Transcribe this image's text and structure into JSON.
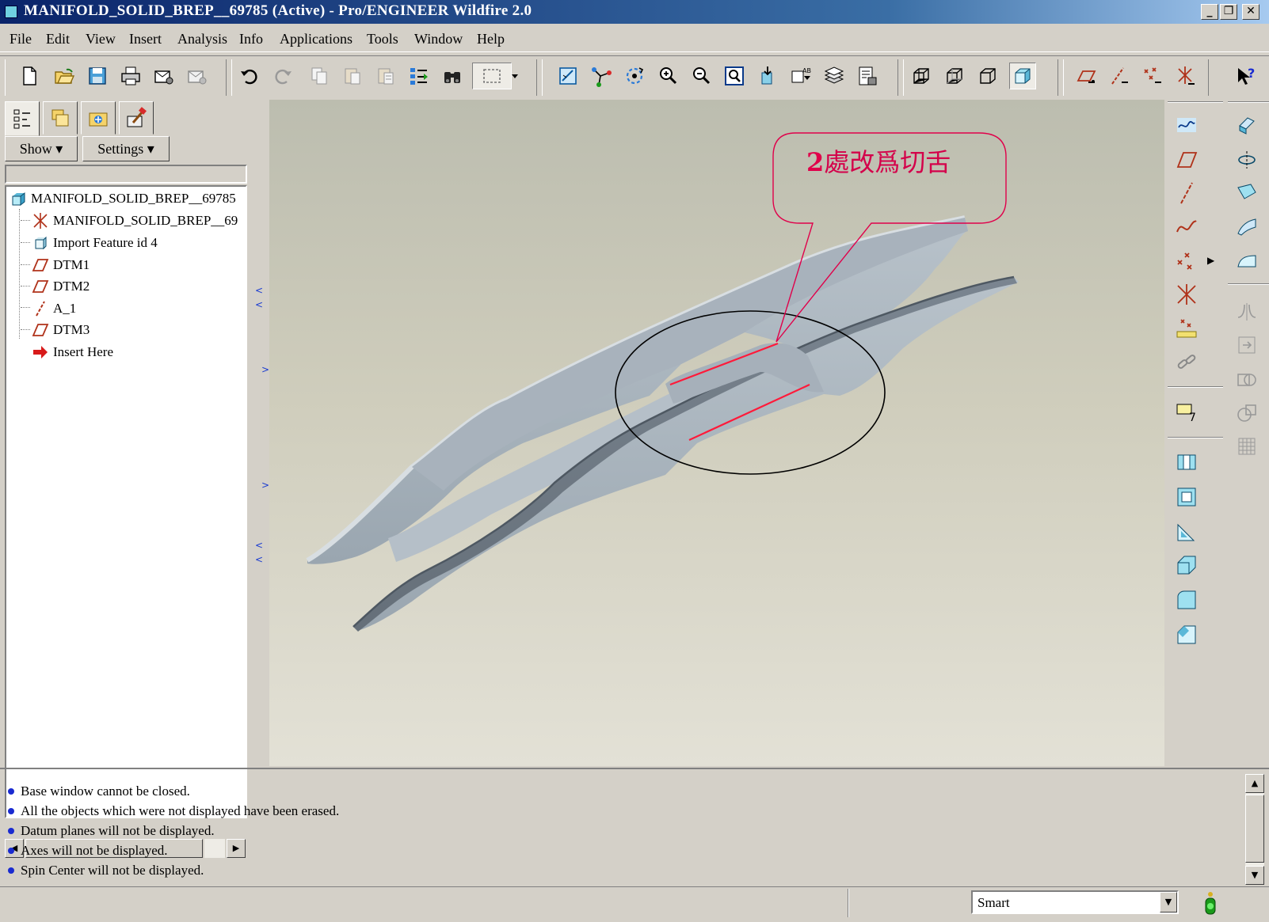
{
  "window": {
    "title": "MANIFOLD_SOLID_BREP__69785 (Active) - Pro/ENGINEER Wildfire 2.0",
    "minimize": "_",
    "restore": "❐",
    "close": "✕"
  },
  "menu": {
    "items": [
      "File",
      "Edit",
      "View",
      "Insert",
      "Analysis",
      "Info",
      "Applications",
      "Tools",
      "Window",
      "Help"
    ]
  },
  "left_panel": {
    "show_label": "Show ▾",
    "settings_label": "Settings ▾",
    "tree": [
      {
        "label": "MANIFOLD_SOLID_BREP__69785",
        "icon": "part-icon"
      },
      {
        "label": "MANIFOLD_SOLID_BREP__69",
        "icon": "csys-icon"
      },
      {
        "label": "Import Feature id 4",
        "icon": "import-feature-icon"
      },
      {
        "label": "DTM1",
        "icon": "datum-plane-icon"
      },
      {
        "label": "DTM2",
        "icon": "datum-plane-icon"
      },
      {
        "label": "A_1",
        "icon": "datum-axis-icon"
      },
      {
        "label": "DTM3",
        "icon": "datum-plane-icon"
      },
      {
        "label": "Insert Here",
        "icon": "insert-here-arrow-icon"
      }
    ]
  },
  "annotation": {
    "callout_number": "2",
    "callout_text": "處改爲切舌"
  },
  "messages": [
    "Base window cannot be closed.",
    "All the objects which were not displayed have been erased.",
    "Datum planes will not be displayed.",
    "Axes will not be displayed.",
    "Spin Center will not be displayed."
  ],
  "status": {
    "filter_value": "Smart"
  },
  "colors": {
    "title_bar": "#0a246a",
    "callout_red": "#e0004a",
    "model_gray": "#8a95a0"
  }
}
